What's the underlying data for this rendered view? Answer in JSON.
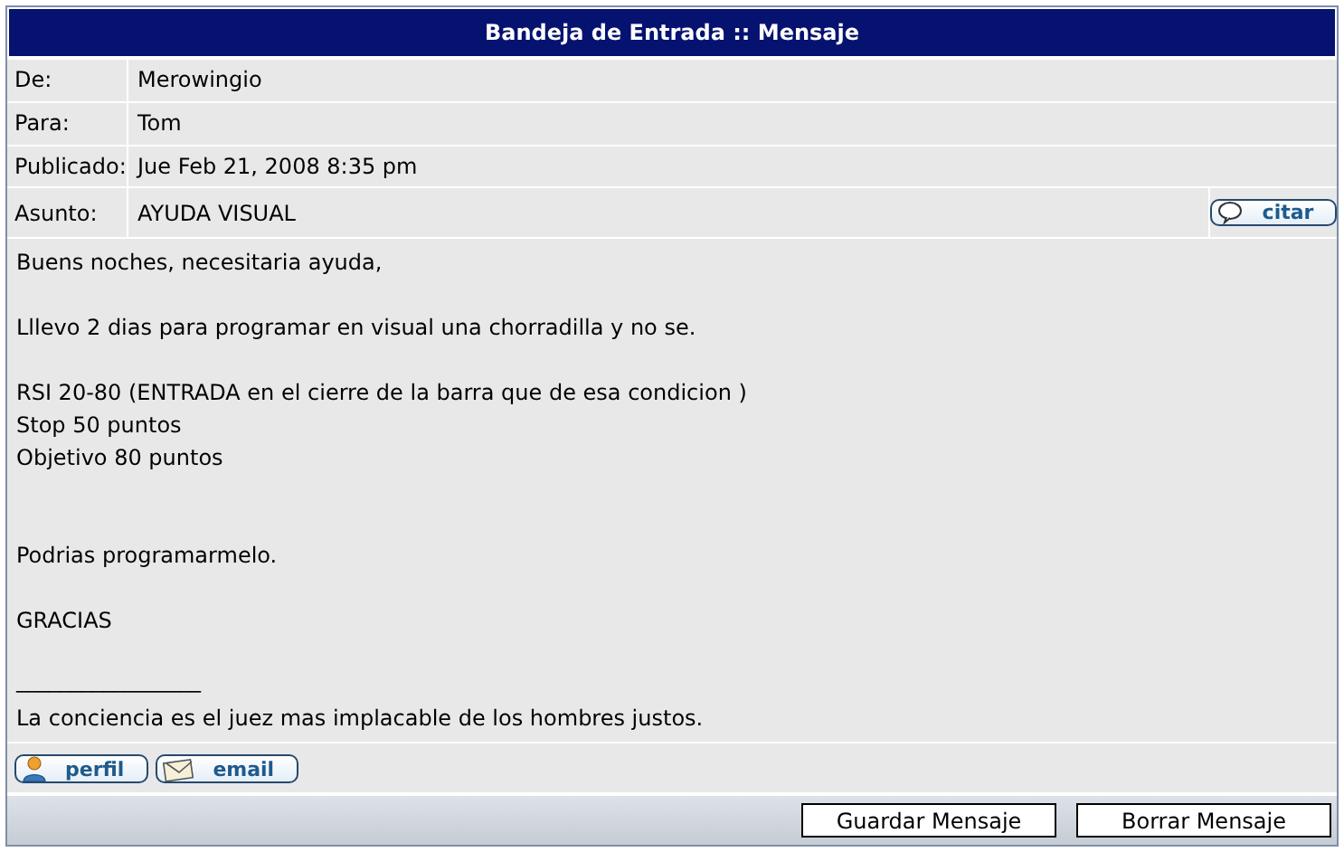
{
  "title": "Bandeja de Entrada :: Mensaje",
  "fields": [
    {
      "label": "De:",
      "value": "Merowingio"
    },
    {
      "label": "Para:",
      "value": "Tom"
    },
    {
      "label": "Publicado:",
      "value": "Jue Feb 21, 2008 8:35 pm"
    },
    {
      "label": "Asunto:",
      "value": "AYUDA VISUAL"
    }
  ],
  "quote_button": "citar",
  "body": "Buens noches, necesitaria ayuda,\n\nLllevo 2 dias para programar en visual una chorradilla y no se.\n\nRSI 20-80 (ENTRADA en el cierre de la barra que de esa condicion )\nStop 50 puntos\nObjetivo 80 puntos\n\n\nPodrias programarmelo.\n\nGRACIAS\n\n",
  "signature_rule": "_________________",
  "signature": "La conciencia es el juez mas implacable de los hombres justos.",
  "profile_buttons": [
    {
      "kind": "profile",
      "label": "perfil"
    },
    {
      "kind": "email",
      "label": "email"
    }
  ],
  "actions": [
    "Guardar Mensaje",
    "Borrar Mensaje"
  ]
}
